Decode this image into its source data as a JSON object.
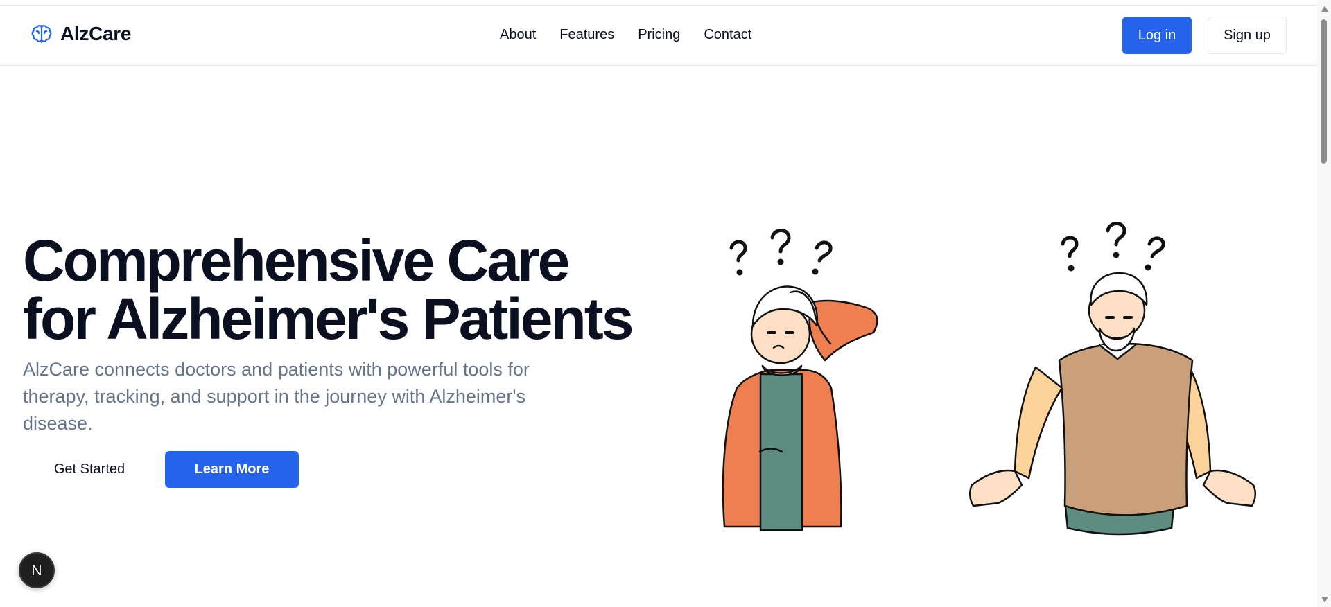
{
  "brand": {
    "name": "AlzCare",
    "logo_icon": "brain-icon",
    "accent_color": "#2563eb"
  },
  "nav": {
    "items": [
      "About",
      "Features",
      "Pricing",
      "Contact"
    ]
  },
  "auth": {
    "login_label": "Log in",
    "signup_label": "Sign up"
  },
  "hero": {
    "title_line1": "Comprehensive Care",
    "title_line2": "for Alzheimer's Patients",
    "subtitle": "AlzCare connects doctors and patients with powerful tools for therapy, tracking, and support in the journey with Alzheimer's disease.",
    "cta_primary": "Get Started",
    "cta_secondary": "Learn More"
  },
  "illustration": {
    "icon": "confused-elderly-couple-illustration"
  },
  "dev_badge": {
    "icon": "next-logo-icon",
    "letter": "N"
  }
}
